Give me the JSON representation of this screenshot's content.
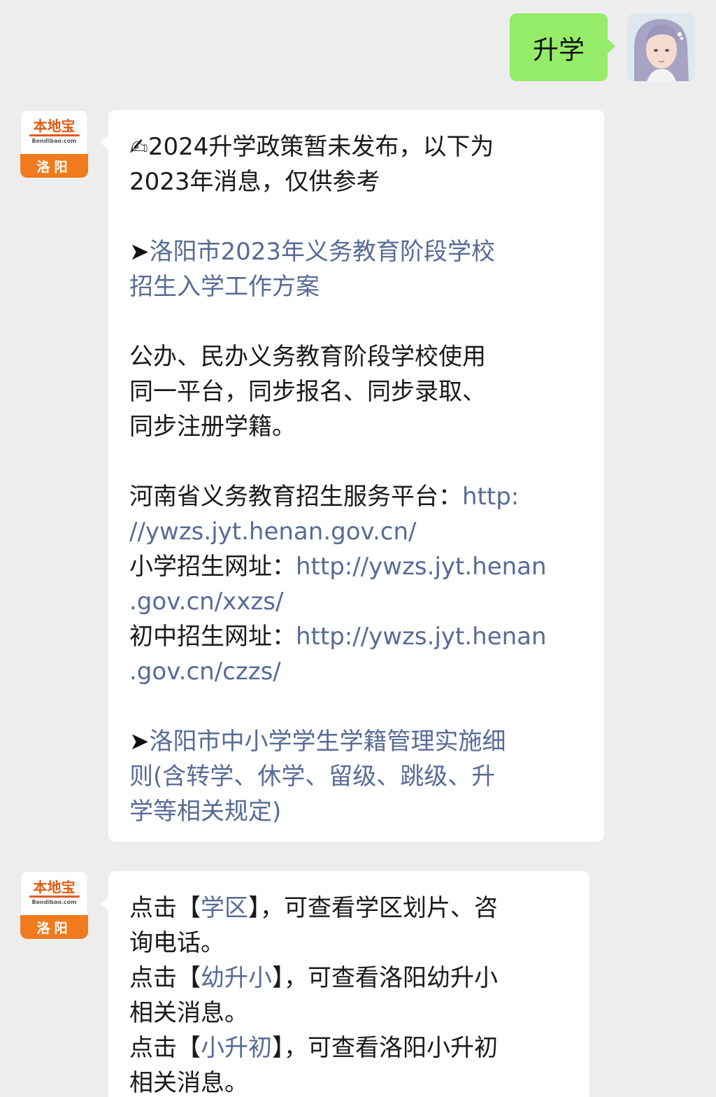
{
  "outgoing": {
    "text": "升学"
  },
  "brand": {
    "name": "本地宝",
    "site": "Bendibao.com",
    "city": "洛阳"
  },
  "message1": {
    "notice_emoji": "✍",
    "notice_line1": "2024升学政策暂未发布，以下为",
    "notice_line2": "2023年消息，仅供参考",
    "arrow": "➤",
    "link1_line1": "洛阳市2023年义务教育阶段学校",
    "link1_line2": "招生入学工作方案",
    "para_line1": "公办、民办义务教育阶段学校使用",
    "para_line2": "同一平台，同步报名、同步录取、",
    "para_line3": "同步注册学籍。",
    "platform_label": "河南省义务教育招生服务平台：",
    "platform_url_part1": "http:",
    "platform_url_part2": "//ywzs.jyt.henan.gov.cn/",
    "primary_label": "小学招生网址：",
    "primary_url_part1": "http://ywzs.jyt.henan",
    "primary_url_part2": ".gov.cn/xxzs/",
    "junior_label": "初中招生网址：",
    "junior_url_part1": "http://ywzs.jyt.henan",
    "junior_url_part2": ".gov.cn/czzs/",
    "link2_line1": "洛阳市中小学学生学籍管理实施细",
    "link2_line2": "则(含转学、休学、留级、跳级、升",
    "link2_line3": "学等相关规定)"
  },
  "message2": {
    "click_prefix": "点击【",
    "bracket_close": "】",
    "item1_keyword": "学区",
    "item1_rest": "，可查看学区划片、咨",
    "item1_line2": "询电话。",
    "item2_keyword": "幼升小",
    "item2_rest": "，可查看洛阳幼升小",
    "item2_line2": "相关消息。",
    "item3_keyword": "小升初",
    "item3_rest": "，可查看洛阳小升初",
    "item3_line2": "相关消息。"
  },
  "colors": {
    "background": "#ededed",
    "outgoing_bubble": "#95ec69",
    "incoming_bubble": "#ffffff",
    "link": "#576b95",
    "brand_orange": "#f07a1d"
  },
  "icons": {
    "notice": "writing-hand-icon",
    "arrow": "right-arrow-icon"
  }
}
